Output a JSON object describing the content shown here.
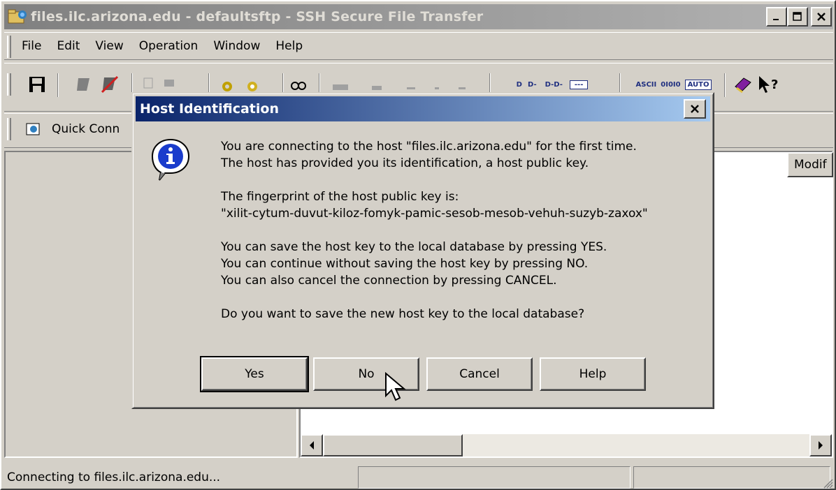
{
  "window": {
    "title": "files.ilc.arizona.edu - defaultsftp - SSH Secure File Transfer",
    "buttons": [
      "minimize-icon",
      "maximize-icon",
      "close-icon"
    ]
  },
  "menu": [
    {
      "label": "File"
    },
    {
      "label": "Edit"
    },
    {
      "label": "View"
    },
    {
      "label": "Operation"
    },
    {
      "label": "Window"
    },
    {
      "label": "Help"
    }
  ],
  "toolbar": {
    "icons": [
      "save-icon",
      "connect-icon",
      "disconnect-icon",
      "copy-icon",
      "paste-icon",
      "settings-icon",
      "profile-icon",
      "find-icon",
      "upload-icon",
      "download-icon",
      "transfer-mode-icons",
      "help-book-icon",
      "context-help-icon"
    ],
    "transfer_labels": {
      "ascii": "ASCII",
      "binary": "0I0I0",
      "auto": "AUTO"
    }
  },
  "quickbar": {
    "quick_connect_label": "Quick Conn"
  },
  "right_pane": {
    "column_modified": "Modif"
  },
  "status": {
    "text": "Connecting to files.ilc.arizona.edu..."
  },
  "dialog": {
    "title": "Host Identification",
    "lines": [
      "You are connecting to the host \"files.ilc.arizona.edu\" for the first time.",
      "The host has provided you its identification, a host public key.",
      "The fingerprint of the host public key is:",
      "\"xilit-cytum-duvut-kiloz-fomyk-pamic-sesob-mesob-vehuh-suzyb-zaxox\"",
      "You can save the host key to the local database by pressing YES.",
      "You can continue without saving the host key by pressing NO.",
      "You can also cancel the connection by pressing CANCEL.",
      "Do you want to save the new host key to the local database?"
    ],
    "buttons": {
      "yes": "Yes",
      "no": "No",
      "cancel": "Cancel",
      "help": "Help"
    }
  }
}
